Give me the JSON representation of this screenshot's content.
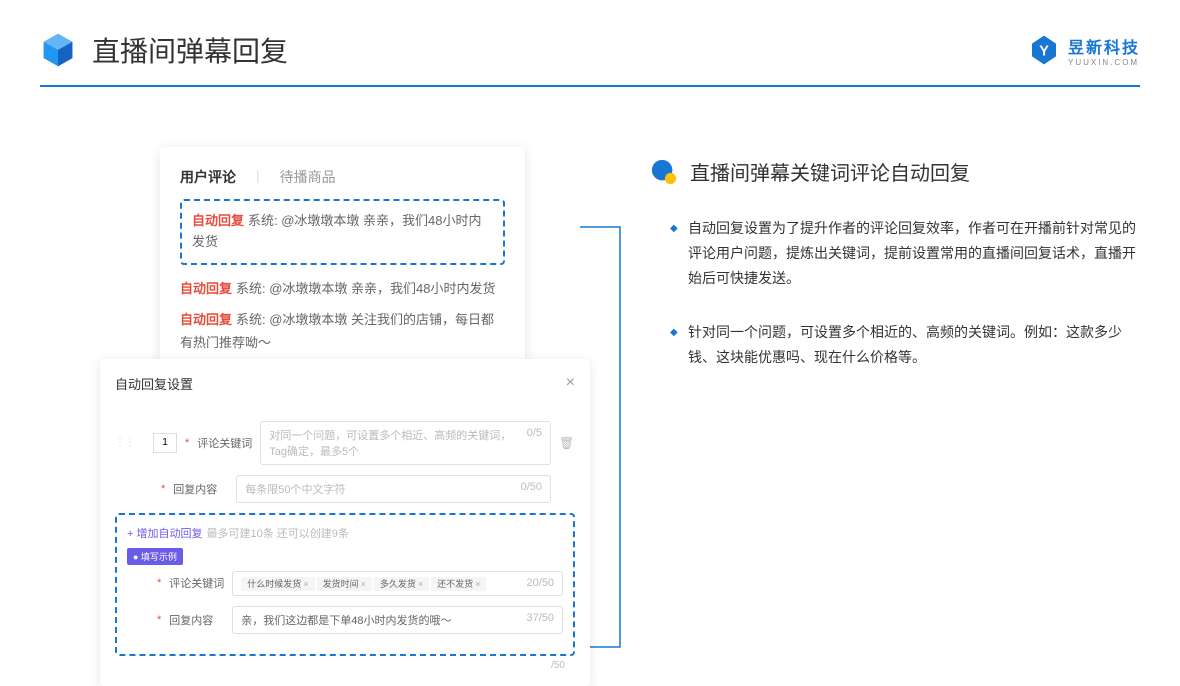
{
  "header": {
    "title": "直播间弹幕回复",
    "brand": {
      "name": "昱新科技",
      "sub": "YUUXIN.COM"
    }
  },
  "commentBox": {
    "tabs": {
      "active": "用户评论",
      "inactive": "待播商品"
    },
    "highlighted": {
      "tag": "自动回复",
      "text": "系统: @冰墩墩本墩 亲亲，我们48小时内发货"
    },
    "rows": [
      {
        "tag": "自动回复",
        "text": "系统: @冰墩墩本墩 亲亲，我们48小时内发货"
      },
      {
        "tag": "自动回复",
        "text": "系统: @冰墩墩本墩 关注我们的店铺，每日都有热门推荐呦～"
      }
    ]
  },
  "settings": {
    "title": "自动回复设置",
    "num": "1",
    "keywordLabel": "评论关键词",
    "keywordPlaceholder": "对同一个问题，可设置多个相近、高频的关键词，Tag确定，最多5个",
    "keywordCount": "0/5",
    "contentLabel": "回复内容",
    "contentPlaceholder": "每条限50个中文字符",
    "contentCount": "0/50",
    "addLink": "+ 增加自动回复",
    "addHint": "最多可建10条 还可以创建9条",
    "exampleBadge": "● 填写示例",
    "exKeywordLabel": "评论关键词",
    "exTags": [
      "什么时候发货",
      "发货时间",
      "多久发货",
      "还不发货"
    ],
    "exKeywordCount": "20/50",
    "exContentLabel": "回复内容",
    "exContentValue": "亲，我们这边都是下单48小时内发货的哦～",
    "exContentCount": "37/50",
    "outerCount": "/50"
  },
  "right": {
    "title": "直播间弹幕关键词评论自动回复",
    "bullets": [
      "自动回复设置为了提升作者的评论回复效率，作者可在开播前针对常见的评论用户问题，提炼出关键词，提前设置常用的直播间回复话术，直播开始后可快捷发送。",
      "针对同一个问题，可设置多个相近的、高频的关键词。例如：这款多少钱、这块能优惠吗、现在什么价格等。"
    ]
  }
}
